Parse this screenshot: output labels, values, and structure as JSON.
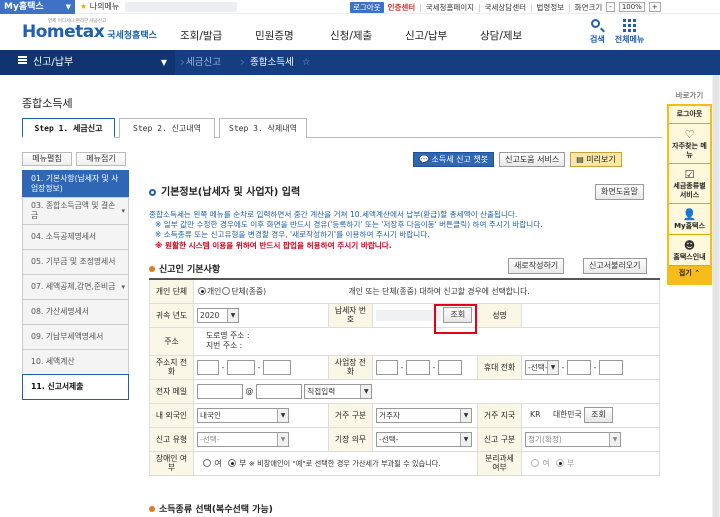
{
  "topbar": {
    "my_tab": "My홈택스",
    "my_menu": "나의메뉴",
    "links": [
      "로그아웃",
      "인증센터",
      "국세청홈페이지",
      "국세상담센터",
      "법령정보",
      "화면크기"
    ],
    "zoom": "100%"
  },
  "header": {
    "logo_main": "Hometax",
    "logo_org": "국세청홈택스",
    "logo_tag": "언제 어디서나 편리한 세금신고",
    "gnb": [
      "조회/발급",
      "민원증명",
      "신청/제출",
      "신고/납부",
      "상담/제보"
    ],
    "search_label": "검색",
    "allmenu_label": "전체메뉴"
  },
  "navbar": {
    "section": "신고/납부",
    "crumbs": [
      "세금신고",
      "종합소득세"
    ]
  },
  "page": {
    "title": "종합소득세",
    "steps": [
      "Step 1. 세금신고",
      "Step 2. 신고내역",
      "Step 3. 삭제내역"
    ]
  },
  "sidebar": {
    "edit_btn": "메뉴펼침",
    "collapse_btn": "메뉴접기",
    "items": [
      "01. 기본사항(납세자 및 사업장정보)",
      "03. 종합소득금액 및 결손금",
      "04. 소득공제명세서",
      "05. 기부금 및 조정명세서",
      "07. 세액공제,감면,준비금",
      "08. 가산세명세서",
      "09. 기납부세액명세서",
      "10. 세액계산",
      "11. 신고서제출"
    ]
  },
  "toolbar": {
    "chatbot": "소득세 신고 챗봇",
    "help_service": "신고도움 서비스",
    "preview": "미리보기"
  },
  "section": {
    "title": "기본정보(납세자 및 사업자) 입력",
    "help_btn": "화면도움말",
    "notice": [
      "종합소득세는 왼쪽 메뉴를 순차로 입력하면서 중간 계산을 거쳐 10.세액계산에서 납부(환급)할 총세액이 산출됩니다.",
      "※ 일부 값만 수정한 경우에도 이후 화면을 반드시 경유('등록하기' 또는 '저장후 다음이동' 버튼클릭) 하여 주시기 바랍니다.",
      "※ 소득종류 또는 신고유형을 변경할 경우, '새로작성하기'를 이용하여 주시기 바랍니다."
    ],
    "notice_red": "※ 원활한 시스템 이용을 위하여 반드시 팝업을 허용하여 주시기 바랍니다."
  },
  "basic": {
    "title": "신고인 기본사항",
    "new_btn": "새로작성하기",
    "load_btn": "신고서불러오기",
    "labels": {
      "individual": "개인 단체",
      "year": "귀속 년도",
      "taxpayer_no": "납세자 번호",
      "name": "성명",
      "address": "주소",
      "home_phone": "주소지 전화",
      "biz_phone": "사업장 전화",
      "mobile": "휴대 전화",
      "email": "전자 메일",
      "foreigner": "내 외국인",
      "residence": "거주 구분",
      "country": "거주 지국",
      "type": "신고 유형",
      "duty": "기장 의무",
      "category": "신고 구분",
      "disabled": "장애인 여부",
      "separate": "분리과세 여부"
    },
    "radio_individual": "개인",
    "radio_group": "단체(종중)",
    "individual_note": "개인 또는 단체(종중) 대하여 신고할 경우에 선택합니다.",
    "year_value": "2020",
    "lookup_btn": "조회",
    "road_addr": "도로명 주소 :",
    "lot_addr": "지번 주소 :",
    "mobile_sel": "-선택-",
    "email_at": "@",
    "email_sel": "직접입력",
    "foreigner_value": "내국인",
    "residence_value": "거주자",
    "country_code": "KR",
    "country_name": "대한민국",
    "country_btn": "조회",
    "type_sel": "-선택-",
    "duty_sel": "-선택-",
    "category_sel": "정기(확정)",
    "yes": "여",
    "no": "부",
    "disabled_note": "※ 비장애인이 \"예\"로 선택한 경우 가산세가 부과될 수 있습니다."
  },
  "footer_section": "소득종류 선택(복수선택 가능)",
  "rightpanel": {
    "title": "바로가기",
    "items": [
      "로그아웃",
      "자주찾는 메뉴",
      "세금종류별 서비스",
      "My홈택스",
      "홈택스인내"
    ],
    "close": "접기"
  }
}
